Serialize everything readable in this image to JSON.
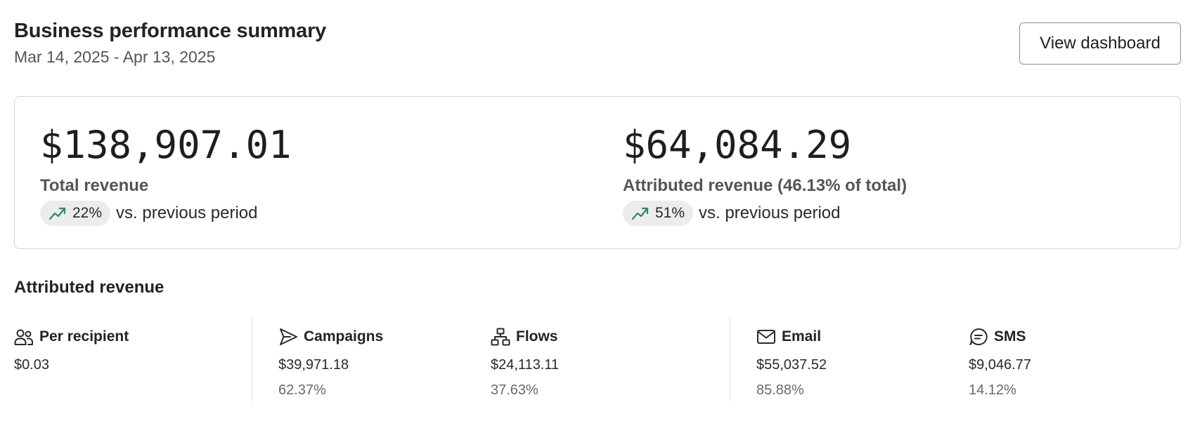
{
  "header": {
    "title": "Business performance summary",
    "date_range": "Mar 14, 2025 - Apr 13, 2025",
    "view_button_label": "View dashboard"
  },
  "summary": {
    "total": {
      "value": "$138,907.01",
      "label": "Total revenue",
      "change": "22%",
      "change_suffix": "vs. previous period"
    },
    "attributed": {
      "value": "$64,084.29",
      "label": "Attributed revenue (46.13% of total)",
      "change": "51%",
      "change_suffix": "vs. previous period"
    }
  },
  "section": {
    "title": "Attributed revenue"
  },
  "stats": {
    "per_recipient": {
      "icon": "users-icon",
      "name": "Per recipient",
      "value": "$0.03"
    },
    "campaigns": {
      "icon": "send-icon",
      "name": "Campaigns",
      "value": "$39,971.18",
      "pct": "62.37%"
    },
    "flows": {
      "icon": "flow-icon",
      "name": "Flows",
      "value": "$24,113.11",
      "pct": "37.63%"
    },
    "email": {
      "icon": "mail-icon",
      "name": "Email",
      "value": "$55,037.52",
      "pct": "85.88%"
    },
    "sms": {
      "icon": "chat-icon",
      "name": "SMS",
      "value": "$9,046.77",
      "pct": "14.12%"
    }
  },
  "colors": {
    "trend_up": "#2e8b57",
    "pill_bg": "#ececec",
    "border": "#d4d4d4"
  }
}
